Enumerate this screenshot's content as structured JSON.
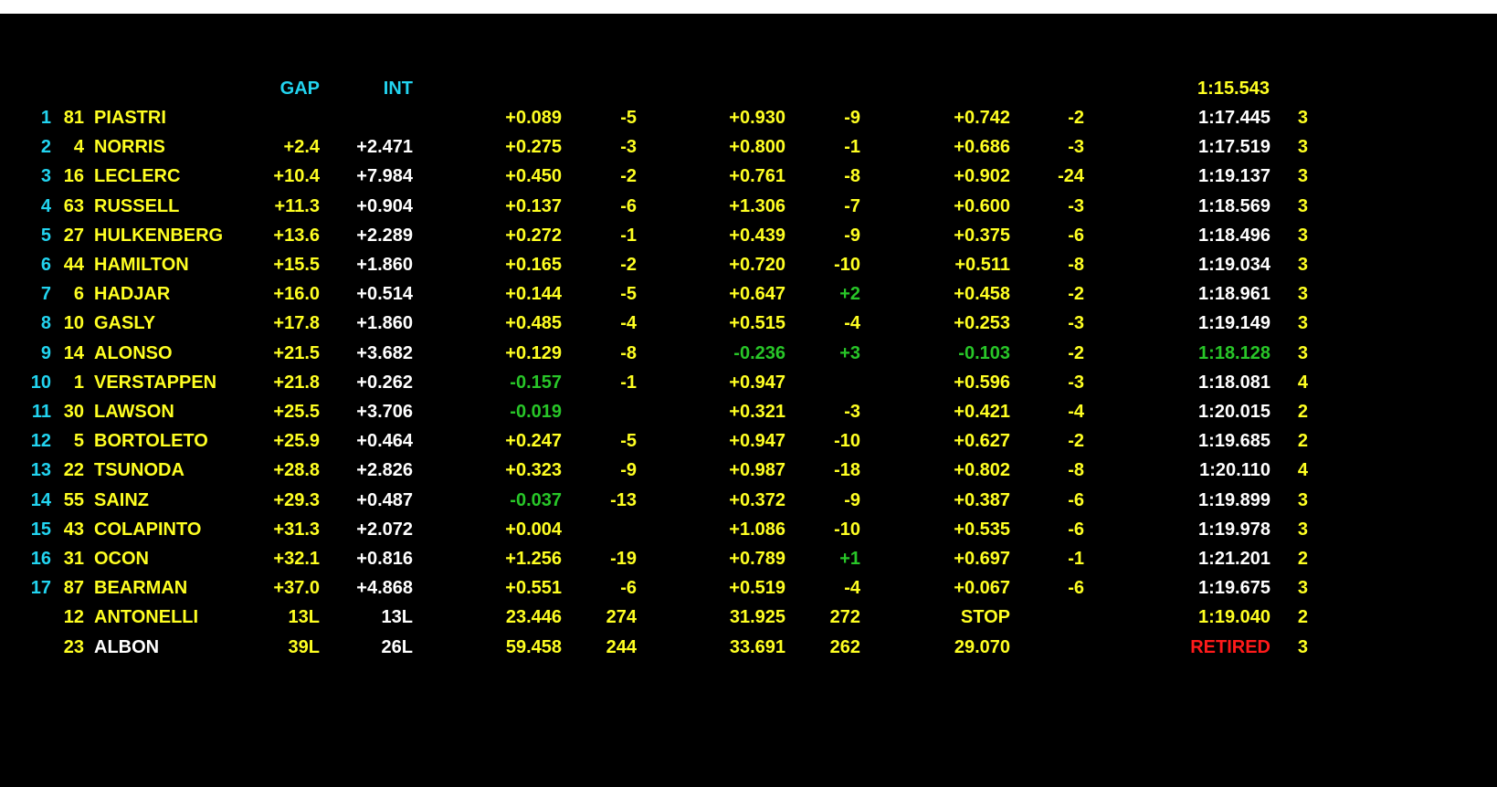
{
  "colors": {
    "background": "#000000",
    "top_bar": "#ffffff",
    "cyan": "#22d4f0",
    "yellow": "#ffff22",
    "white": "#ffffff",
    "green": "#28c628",
    "red": "#ff1a1a"
  },
  "header": {
    "gap_label": "GAP",
    "int_label": "INT",
    "best_time": "1:15.543"
  },
  "rows": [
    {
      "pos": "1",
      "num": "81",
      "name": "PIASTRI",
      "gap": "",
      "int": "",
      "s1": "+0.089",
      "s1c": "yellow",
      "s1r": "-5",
      "s1rc": "yellow",
      "s2": "+0.930",
      "s2c": "yellow",
      "s2r": "-9",
      "s2rc": "yellow",
      "s3": "+0.742",
      "s3c": "yellow",
      "s3r": "-2",
      "s3rc": "yellow",
      "lap": "1:17.445",
      "lapc": "white",
      "pits": "3",
      "namec": "yellow"
    },
    {
      "pos": "2",
      "num": "4",
      "name": "NORRIS",
      "gap": "+2.4",
      "int": "+2.471",
      "s1": "+0.275",
      "s1c": "yellow",
      "s1r": "-3",
      "s1rc": "yellow",
      "s2": "+0.800",
      "s2c": "yellow",
      "s2r": "-1",
      "s2rc": "yellow",
      "s3": "+0.686",
      "s3c": "yellow",
      "s3r": "-3",
      "s3rc": "yellow",
      "lap": "1:17.519",
      "lapc": "white",
      "pits": "3",
      "namec": "yellow"
    },
    {
      "pos": "3",
      "num": "16",
      "name": "LECLERC",
      "gap": "+10.4",
      "int": "+7.984",
      "s1": "+0.450",
      "s1c": "yellow",
      "s1r": "-2",
      "s1rc": "yellow",
      "s2": "+0.761",
      "s2c": "yellow",
      "s2r": "-8",
      "s2rc": "yellow",
      "s3": "+0.902",
      "s3c": "yellow",
      "s3r": "-24",
      "s3rc": "yellow",
      "lap": "1:19.137",
      "lapc": "white",
      "pits": "3",
      "namec": "yellow"
    },
    {
      "pos": "4",
      "num": "63",
      "name": "RUSSELL",
      "gap": "+11.3",
      "int": "+0.904",
      "s1": "+0.137",
      "s1c": "yellow",
      "s1r": "-6",
      "s1rc": "yellow",
      "s2": "+1.306",
      "s2c": "yellow",
      "s2r": "-7",
      "s2rc": "yellow",
      "s3": "+0.600",
      "s3c": "yellow",
      "s3r": "-3",
      "s3rc": "yellow",
      "lap": "1:18.569",
      "lapc": "white",
      "pits": "3",
      "namec": "yellow"
    },
    {
      "pos": "5",
      "num": "27",
      "name": "HULKENBERG",
      "gap": "+13.6",
      "int": "+2.289",
      "s1": "+0.272",
      "s1c": "yellow",
      "s1r": "-1",
      "s1rc": "yellow",
      "s2": "+0.439",
      "s2c": "yellow",
      "s2r": "-9",
      "s2rc": "yellow",
      "s3": "+0.375",
      "s3c": "yellow",
      "s3r": "-6",
      "s3rc": "yellow",
      "lap": "1:18.496",
      "lapc": "white",
      "pits": "3",
      "namec": "yellow"
    },
    {
      "pos": "6",
      "num": "44",
      "name": "HAMILTON",
      "gap": "+15.5",
      "int": "+1.860",
      "s1": "+0.165",
      "s1c": "yellow",
      "s1r": "-2",
      "s1rc": "yellow",
      "s2": "+0.720",
      "s2c": "yellow",
      "s2r": "-10",
      "s2rc": "yellow",
      "s3": "+0.511",
      "s3c": "yellow",
      "s3r": "-8",
      "s3rc": "yellow",
      "lap": "1:19.034",
      "lapc": "white",
      "pits": "3",
      "namec": "yellow"
    },
    {
      "pos": "7",
      "num": "6",
      "name": "HADJAR",
      "gap": "+16.0",
      "int": "+0.514",
      "s1": "+0.144",
      "s1c": "yellow",
      "s1r": "-5",
      "s1rc": "yellow",
      "s2": "+0.647",
      "s2c": "yellow",
      "s2r": "+2",
      "s2rc": "green",
      "s3": "+0.458",
      "s3c": "yellow",
      "s3r": "-2",
      "s3rc": "yellow",
      "lap": "1:18.961",
      "lapc": "white",
      "pits": "3",
      "namec": "yellow"
    },
    {
      "pos": "8",
      "num": "10",
      "name": "GASLY",
      "gap": "+17.8",
      "int": "+1.860",
      "s1": "+0.485",
      "s1c": "yellow",
      "s1r": "-4",
      "s1rc": "yellow",
      "s2": "+0.515",
      "s2c": "yellow",
      "s2r": "-4",
      "s2rc": "yellow",
      "s3": "+0.253",
      "s3c": "yellow",
      "s3r": "-3",
      "s3rc": "yellow",
      "lap": "1:19.149",
      "lapc": "white",
      "pits": "3",
      "namec": "yellow"
    },
    {
      "pos": "9",
      "num": "14",
      "name": "ALONSO",
      "gap": "+21.5",
      "int": "+3.682",
      "s1": "+0.129",
      "s1c": "yellow",
      "s1r": "-8",
      "s1rc": "yellow",
      "s2": "-0.236",
      "s2c": "green",
      "s2r": "+3",
      "s2rc": "green",
      "s3": "-0.103",
      "s3c": "green",
      "s3r": "-2",
      "s3rc": "yellow",
      "lap": "1:18.128",
      "lapc": "green",
      "pits": "3",
      "namec": "yellow"
    },
    {
      "pos": "10",
      "num": "1",
      "name": "VERSTAPPEN",
      "gap": "+21.8",
      "int": "+0.262",
      "s1": "-0.157",
      "s1c": "green",
      "s1r": "-1",
      "s1rc": "yellow",
      "s2": "+0.947",
      "s2c": "yellow",
      "s2r": "",
      "s2rc": "yellow",
      "s3": "+0.596",
      "s3c": "yellow",
      "s3r": "-3",
      "s3rc": "yellow",
      "lap": "1:18.081",
      "lapc": "white",
      "pits": "4",
      "namec": "yellow"
    },
    {
      "pos": "11",
      "num": "30",
      "name": "LAWSON",
      "gap": "+25.5",
      "int": "+3.706",
      "s1": "-0.019",
      "s1c": "green",
      "s1r": "",
      "s1rc": "yellow",
      "s2": "+0.321",
      "s2c": "yellow",
      "s2r": "-3",
      "s2rc": "yellow",
      "s3": "+0.421",
      "s3c": "yellow",
      "s3r": "-4",
      "s3rc": "yellow",
      "lap": "1:20.015",
      "lapc": "white",
      "pits": "2",
      "namec": "yellow"
    },
    {
      "pos": "12",
      "num": "5",
      "name": "BORTOLETO",
      "gap": "+25.9",
      "int": "+0.464",
      "s1": "+0.247",
      "s1c": "yellow",
      "s1r": "-5",
      "s1rc": "yellow",
      "s2": "+0.947",
      "s2c": "yellow",
      "s2r": "-10",
      "s2rc": "yellow",
      "s3": "+0.627",
      "s3c": "yellow",
      "s3r": "-2",
      "s3rc": "yellow",
      "lap": "1:19.685",
      "lapc": "white",
      "pits": "2",
      "namec": "yellow"
    },
    {
      "pos": "13",
      "num": "22",
      "name": "TSUNODA",
      "gap": "+28.8",
      "int": "+2.826",
      "s1": "+0.323",
      "s1c": "yellow",
      "s1r": "-9",
      "s1rc": "yellow",
      "s2": "+0.987",
      "s2c": "yellow",
      "s2r": "-18",
      "s2rc": "yellow",
      "s3": "+0.802",
      "s3c": "yellow",
      "s3r": "-8",
      "s3rc": "yellow",
      "lap": "1:20.110",
      "lapc": "white",
      "pits": "4",
      "namec": "yellow"
    },
    {
      "pos": "14",
      "num": "55",
      "name": "SAINZ",
      "gap": "+29.3",
      "int": "+0.487",
      "s1": "-0.037",
      "s1c": "green",
      "s1r": "-13",
      "s1rc": "yellow",
      "s2": "+0.372",
      "s2c": "yellow",
      "s2r": "-9",
      "s2rc": "yellow",
      "s3": "+0.387",
      "s3c": "yellow",
      "s3r": "-6",
      "s3rc": "yellow",
      "lap": "1:19.899",
      "lapc": "white",
      "pits": "3",
      "namec": "yellow"
    },
    {
      "pos": "15",
      "num": "43",
      "name": "COLAPINTO",
      "gap": "+31.3",
      "int": "+2.072",
      "s1": "+0.004",
      "s1c": "yellow",
      "s1r": "",
      "s1rc": "yellow",
      "s2": "+1.086",
      "s2c": "yellow",
      "s2r": "-10",
      "s2rc": "yellow",
      "s3": "+0.535",
      "s3c": "yellow",
      "s3r": "-6",
      "s3rc": "yellow",
      "lap": "1:19.978",
      "lapc": "white",
      "pits": "3",
      "namec": "yellow"
    },
    {
      "pos": "16",
      "num": "31",
      "name": "OCON",
      "gap": "+32.1",
      "int": "+0.816",
      "s1": "+1.256",
      "s1c": "yellow",
      "s1r": "-19",
      "s1rc": "yellow",
      "s2": "+0.789",
      "s2c": "yellow",
      "s2r": "+1",
      "s2rc": "green",
      "s3": "+0.697",
      "s3c": "yellow",
      "s3r": "-1",
      "s3rc": "yellow",
      "lap": "1:21.201",
      "lapc": "white",
      "pits": "2",
      "namec": "yellow"
    },
    {
      "pos": "17",
      "num": "87",
      "name": "BEARMAN",
      "gap": "+37.0",
      "int": "+4.868",
      "s1": "+0.551",
      "s1c": "yellow",
      "s1r": "-6",
      "s1rc": "yellow",
      "s2": "+0.519",
      "s2c": "yellow",
      "s2r": "-4",
      "s2rc": "yellow",
      "s3": "+0.067",
      "s3c": "yellow",
      "s3r": "-6",
      "s3rc": "yellow",
      "lap": "1:19.675",
      "lapc": "white",
      "pits": "3",
      "namec": "yellow"
    },
    {
      "pos": "",
      "num": "12",
      "name": "ANTONELLI",
      "gap": "13L",
      "int": "13L",
      "s1": "23.446",
      "s1c": "yellow",
      "s1r": "274",
      "s1rc": "yellow",
      "s2": "31.925",
      "s2c": "yellow",
      "s2r": "272",
      "s2rc": "yellow",
      "s3": "STOP",
      "s3c": "yellow",
      "s3r": "",
      "s3rc": "yellow",
      "lap": "1:19.040",
      "lapc": "yellow",
      "pits": "2",
      "namec": "yellow"
    },
    {
      "pos": "",
      "num": "23",
      "name": "ALBON",
      "gap": "39L",
      "int": "26L",
      "s1": "59.458",
      "s1c": "yellow",
      "s1r": "244",
      "s1rc": "yellow",
      "s2": "33.691",
      "s2c": "yellow",
      "s2r": "262",
      "s2rc": "yellow",
      "s3": "29.070",
      "s3c": "yellow",
      "s3r": "",
      "s3rc": "yellow",
      "lap": "RETIRED",
      "lapc": "red",
      "pits": "3",
      "namec": "white"
    }
  ]
}
